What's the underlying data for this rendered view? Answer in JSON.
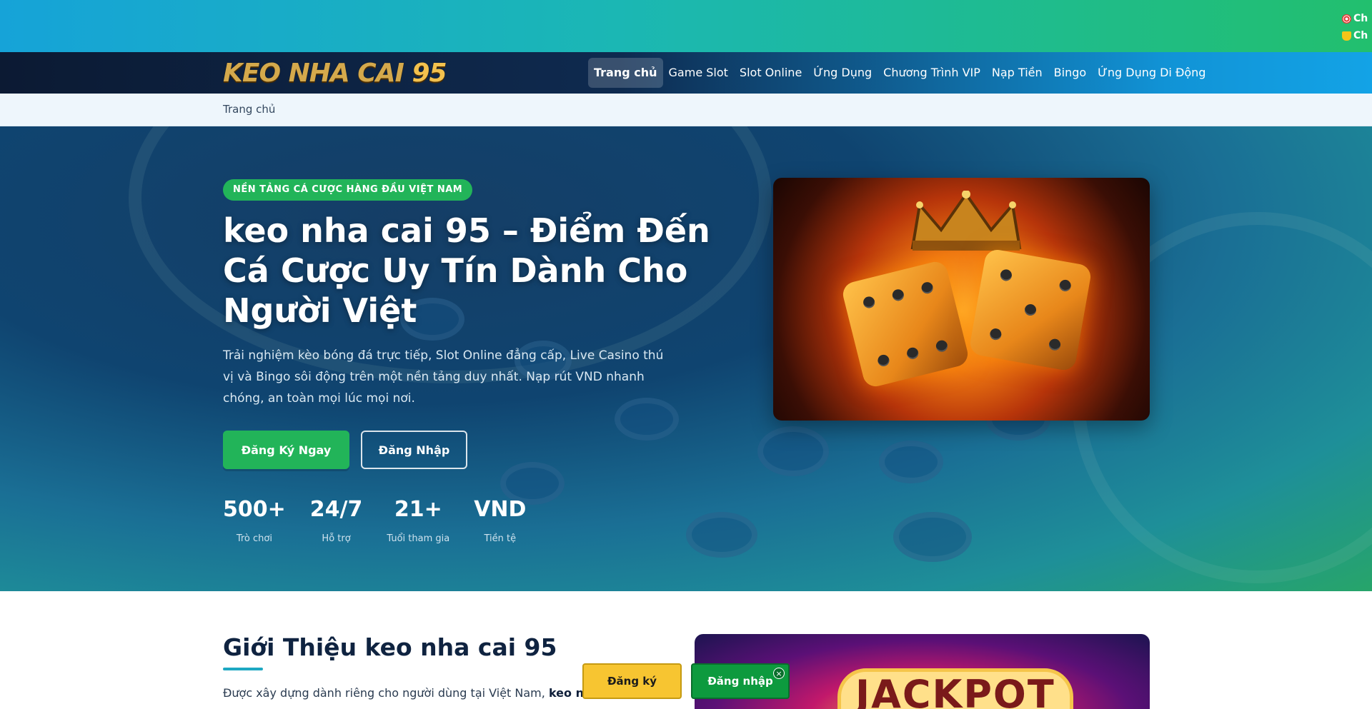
{
  "ticker": {
    "items": [
      {
        "icon": "target-icon",
        "text": "Ch"
      },
      {
        "icon": "trophy-icon",
        "text": "Ch"
      }
    ]
  },
  "header": {
    "logo_text": "KEO NHA CAI",
    "logo_number": "95",
    "nav": [
      {
        "label": "Trang chủ",
        "active": true
      },
      {
        "label": "Game Slot"
      },
      {
        "label": "Slot Online"
      },
      {
        "label": "Ứng Dụng"
      },
      {
        "label": "Chương Trình VIP"
      },
      {
        "label": "Nạp Tiền"
      },
      {
        "label": "Bingo"
      },
      {
        "label": "Ứng Dụng Di Động"
      }
    ]
  },
  "breadcrumb": {
    "current": "Trang chủ"
  },
  "hero": {
    "badge": "NỀN TẢNG CÁ CƯỢC HÀNG ĐẦU VIỆT NAM",
    "title": "keo nha cai 95 – Điểm Đến Cá Cược Uy Tín Dành Cho Người Việt",
    "description": "Trải nghiệm kèo bóng đá trực tiếp, Slot Online đẳng cấp, Live Casino thú vị và Bingo sôi động trên một nền tảng duy nhất. Nạp rút VND nhanh chóng, an toàn mọi lúc mọi nơi.",
    "primary_button": "Đăng Ký Ngay",
    "secondary_button": "Đăng Nhập",
    "stats": [
      {
        "value": "500+",
        "label": "Trò chơi"
      },
      {
        "value": "24/7",
        "label": "Hỗ trợ"
      },
      {
        "value": "21+",
        "label": "Tuổi tham gia"
      },
      {
        "value": "VND",
        "label": "Tiền tệ"
      }
    ]
  },
  "intro": {
    "title": "Giới Thiệu keo nha cai 95",
    "text_prefix": "Được xây dựng dành riêng cho người dùng tại Việt Nam,",
    "text_bold": "keo nha",
    "image_word": "JACKPOT"
  },
  "floating": {
    "register_label": "Đăng ký",
    "login_label": "Đăng nhập",
    "close_symbol": "×"
  },
  "colors": {
    "accent_green": "#22b459",
    "nav_dark": "#0c1a33",
    "register_yellow": "#f7c531"
  }
}
